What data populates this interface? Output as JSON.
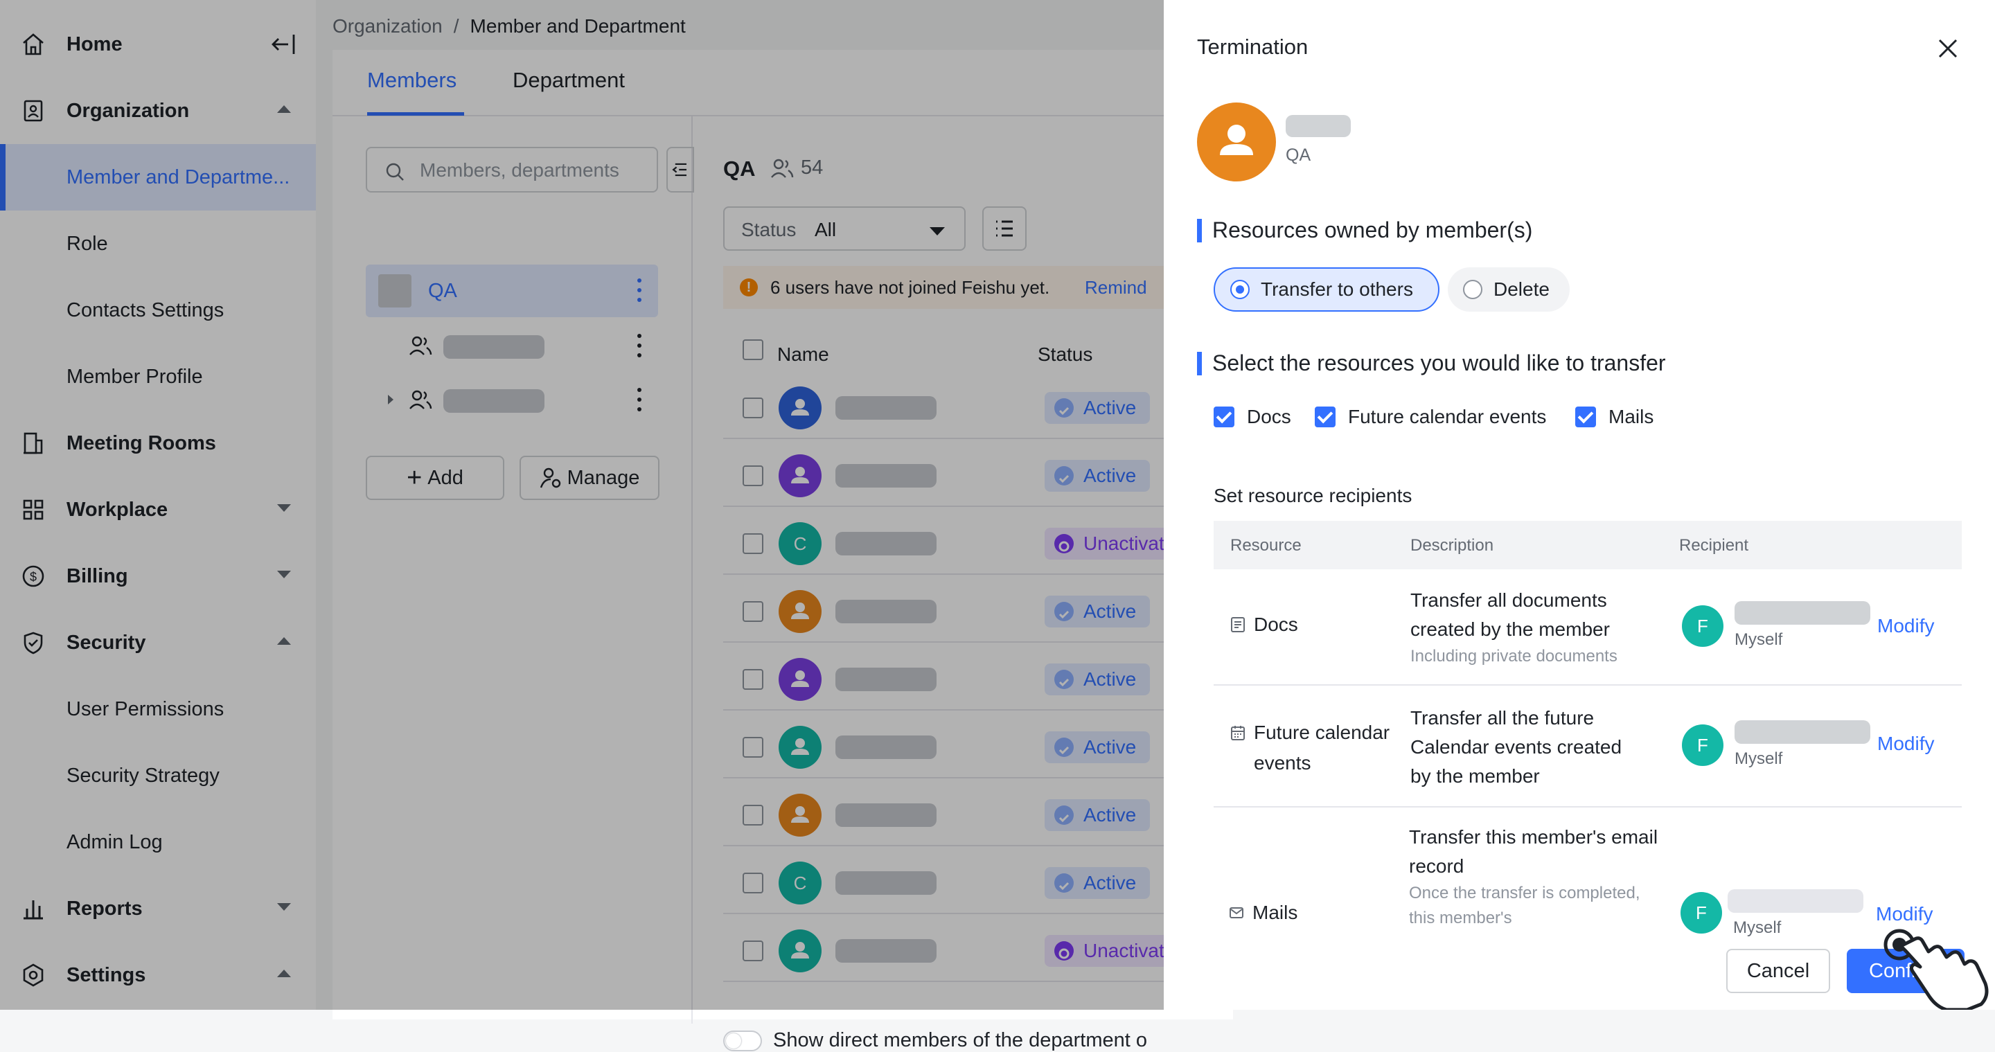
{
  "sidebar": {
    "items": [
      {
        "label": "Home",
        "icon": "home-icon",
        "type": "parent"
      },
      {
        "label": "Organization",
        "icon": "contacts-book-icon",
        "type": "parent",
        "caret": "up"
      },
      {
        "label": "Member and Departme...",
        "type": "child",
        "active": true
      },
      {
        "label": "Role",
        "type": "child"
      },
      {
        "label": "Contacts Settings",
        "type": "child"
      },
      {
        "label": "Member Profile",
        "type": "child"
      },
      {
        "label": "Meeting Rooms",
        "icon": "building-icon",
        "type": "parent"
      },
      {
        "label": "Workplace",
        "icon": "grid-icon",
        "type": "parent",
        "caret": "down"
      },
      {
        "label": "Billing",
        "icon": "dollar-icon",
        "type": "parent",
        "caret": "down"
      },
      {
        "label": "Security",
        "icon": "shield-icon",
        "type": "parent",
        "caret": "up"
      },
      {
        "label": "User Permissions",
        "type": "child"
      },
      {
        "label": "Security Strategy",
        "type": "child"
      },
      {
        "label": "Admin Log",
        "type": "child"
      },
      {
        "label": "Reports",
        "icon": "bar-chart-icon",
        "type": "parent",
        "caret": "down"
      },
      {
        "label": "Settings",
        "icon": "gear-icon",
        "type": "parent",
        "caret": "up"
      }
    ]
  },
  "breadcrumb": {
    "root": "Organization",
    "sep": "/",
    "current": "Member and Department"
  },
  "tabs": {
    "members": "Members",
    "department": "Department"
  },
  "tree": {
    "search_placeholder": "Members, departments",
    "root": "QA",
    "add": "Add",
    "manage": "Manage"
  },
  "list": {
    "title": "QA",
    "count": "54",
    "status_label": "Status",
    "status_value": "All",
    "banner": "6 users have not joined Feishu yet.",
    "remind": "Remind",
    "col_name": "Name",
    "col_status": "Status",
    "rows": [
      {
        "avatar_color": "#2f64db",
        "avatar_text": "",
        "status": "Active",
        "kind": "active"
      },
      {
        "avatar_color": "#7b3fe4",
        "avatar_text": "",
        "status": "Active",
        "kind": "active"
      },
      {
        "avatar_color": "#14b8a6",
        "avatar_text": "C",
        "status": "Unactivated",
        "kind": "unact"
      },
      {
        "avatar_color": "#e8871e",
        "avatar_text": "",
        "status": "Active",
        "kind": "active"
      },
      {
        "avatar_color": "#7b3fe4",
        "avatar_text": "",
        "status": "Active",
        "kind": "active"
      },
      {
        "avatar_color": "#14b8a6",
        "avatar_text": "",
        "status": "Active",
        "kind": "active"
      },
      {
        "avatar_color": "#e8871e",
        "avatar_text": "",
        "status": "Active",
        "kind": "active"
      },
      {
        "avatar_color": "#14b8a6",
        "avatar_text": "C",
        "status": "Active",
        "kind": "active"
      },
      {
        "avatar_color": "#14b8a6",
        "avatar_text": "",
        "status": "Unactivated",
        "kind": "unact"
      }
    ],
    "toggle_label": "Show direct members of the department o"
  },
  "drawer": {
    "title": "Termination",
    "member_dept": "QA",
    "section1": "Resources owned by member(s)",
    "opt_transfer": "Transfer to others",
    "opt_delete": "Delete",
    "section2": "Select the resources you would like to transfer",
    "chk_docs": "Docs",
    "chk_calendar": "Future calendar events",
    "chk_mails": "Mails",
    "set_label": "Set resource recipients",
    "th_resource": "Resource",
    "th_description": "Description",
    "th_recipient": "Recipient",
    "rows": [
      {
        "name": "Docs",
        "desc": "Transfer all documents created by the member",
        "note": "Including private documents",
        "avatar": "F",
        "sub": "Myself",
        "action": "Modify"
      },
      {
        "name": "Future calendar events",
        "desc": "Transfer all the future Calendar events created by the member",
        "note": "",
        "avatar": "F",
        "sub": "Myself",
        "action": "Modify"
      },
      {
        "name": "Mails",
        "desc": "Transfer this member's email record",
        "note": "Once the transfer is completed, this member's",
        "avatar": "F",
        "sub": "Myself",
        "action": "Modify"
      }
    ],
    "cancel": "Cancel",
    "confirm": "Confirm"
  },
  "colors": {
    "accent": "#3370ff",
    "orange": "#e8871e",
    "teal": "#14b8a6",
    "purple": "#7f3bf5"
  }
}
